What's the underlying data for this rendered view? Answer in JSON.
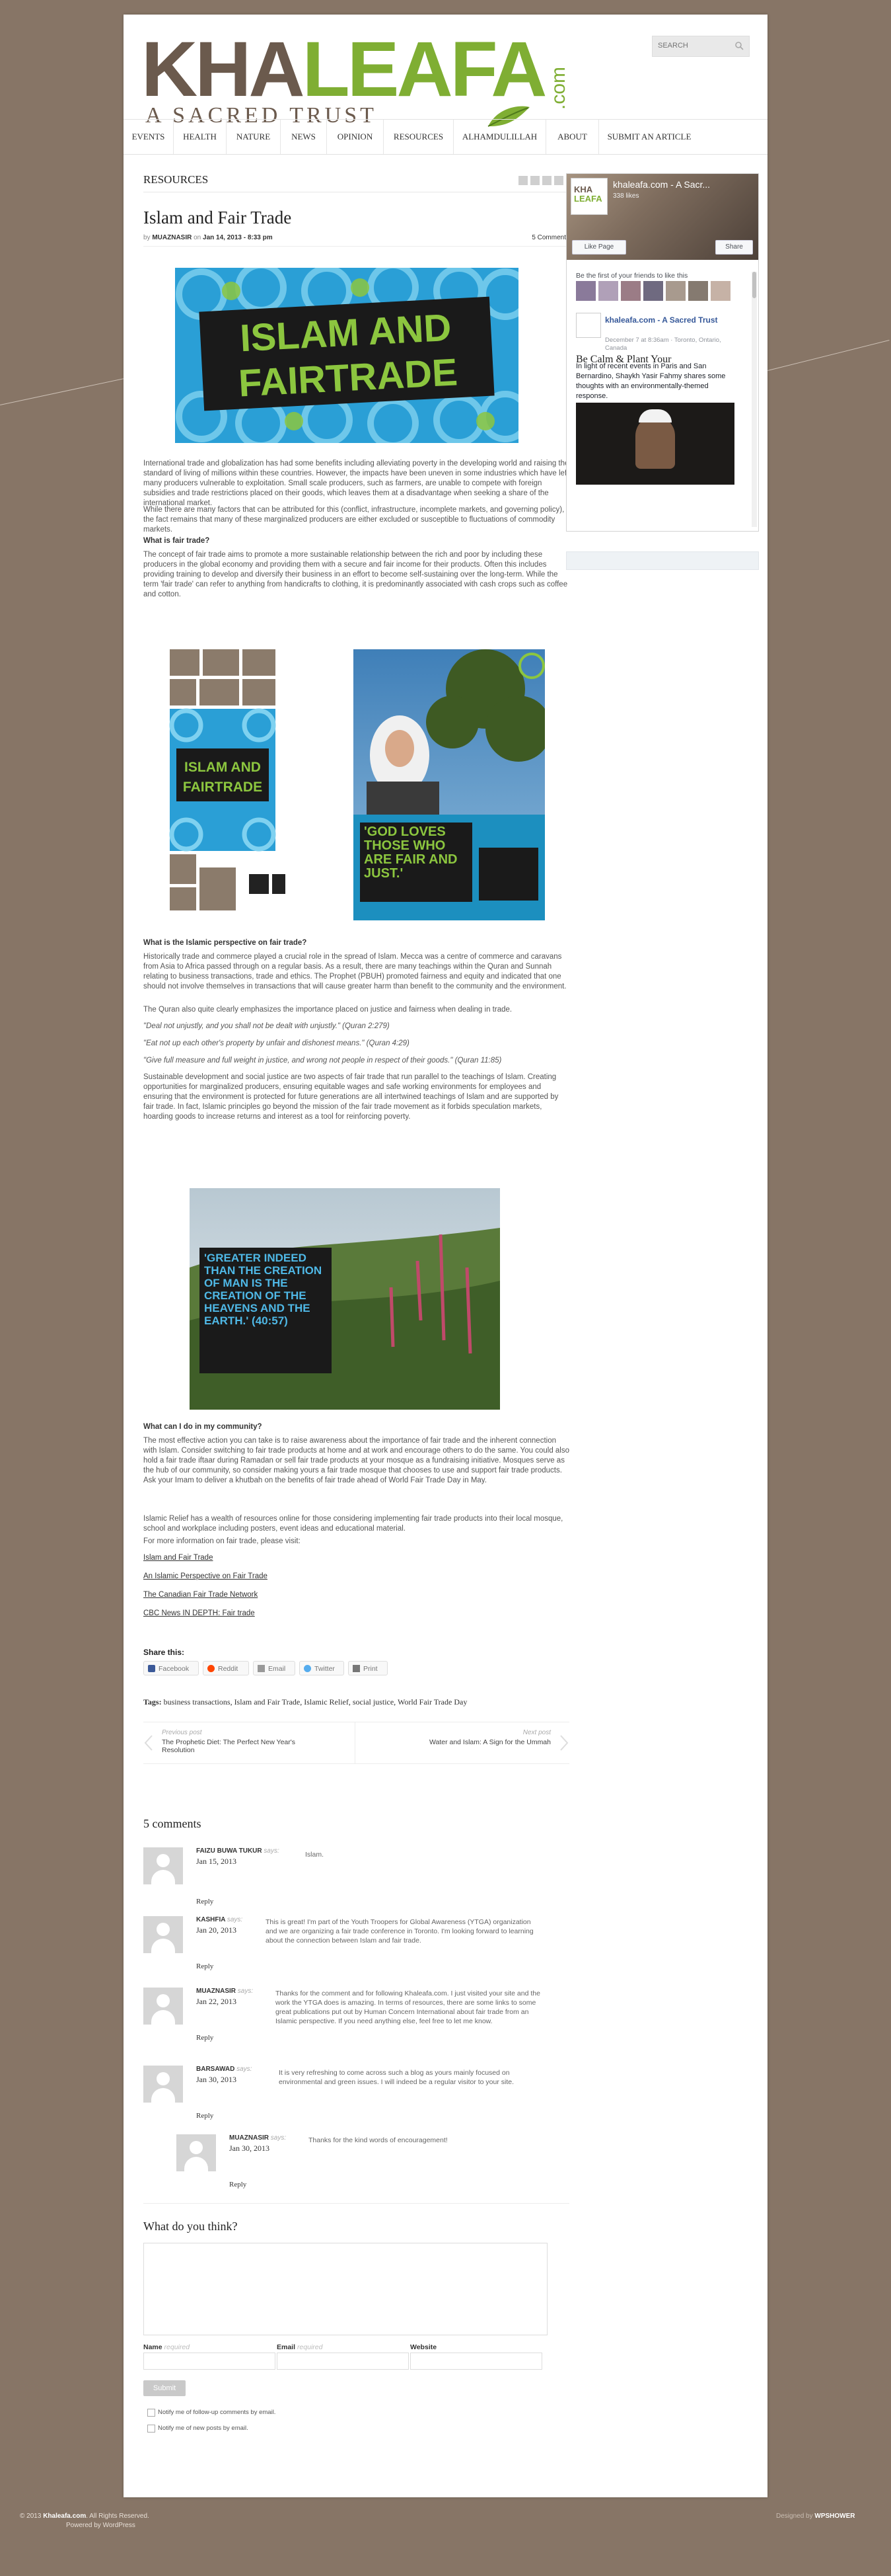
{
  "site": {
    "logo_main": "KHALEAFA",
    "logo_main_dark": "KHA",
    "logo_main_green": "LEAFA",
    "logo_com": ".com",
    "logo_tagline": "A SACRED TRUST",
    "search_placeholder": "SEARCH"
  },
  "nav": [
    "EVENTS",
    "HEALTH",
    "NATURE",
    "NEWS",
    "OPINION",
    "RESOURCES",
    "ALHAMDULILLAH",
    "ABOUT",
    "SUBMIT AN ARTICLE"
  ],
  "section_title": "RESOURCES",
  "post": {
    "title": "Islam and Fair Trade",
    "meta_by": "by",
    "author": "MUAZNASIR",
    "meta_on": "on",
    "date": "Jan 14, 2013 - 8:33 pm",
    "comments_count": "5 Comments",
    "banner_line1": "ISLAM AND",
    "banner_line2": "FAIRTRADE",
    "p1": "International trade and globalization has had some benefits including alleviating poverty in the developing world and raising the standard of living of millions within these countries. However, the impacts have been uneven in some industries which have left many producers vulnerable to exploitation. Small scale producers, such as farmers, are unable to compete with foreign subsidies and trade restrictions placed on their goods, which leaves them at a disadvantage when seeking a share of the international market.",
    "p2": "While there are many factors that can be attributed for this (conflict, infrastructure, incomplete markets, and governing policy), the fact remains that many of these marginalized producers are either excluded or susceptible to fluctuations of commodity markets.",
    "h_what": "What is fair trade?",
    "p3": "The concept of fair trade aims to promote a more sustainable relationship between the rich and poor by including these producers in the global economy and providing them with a secure and fair income for their products. Often this includes providing training to develop and diversify their business in an effort to become self-sustaining over the long-term. While the term 'fair trade' can refer to anything from handicrafts to clothing, it is predominantly associated with cash crops such as coffee and cotton.",
    "poster1_line1": "ISLAM AND",
    "poster1_line2": "FAIRTRADE",
    "poster2_quote": "'GOD LOVES THOSE WHO ARE FAIR AND JUST.'",
    "h_islamic": "What is the Islamic perspective on fair trade?",
    "p4": "Historically trade and commerce played a crucial role in the spread of Islam. Mecca was a centre of commerce and caravans from Asia to Africa passed through on a regular basis. As a result, there are many teachings within the Quran and Sunnah relating to business transactions, trade and ethics. The Prophet (PBUH) promoted fairness and equity and indicated that one should not involve themselves in transactions that will cause greater harm than benefit to the community and the environment.",
    "p5": "The Quran also quite clearly emphasizes the importance placed on justice and fairness when dealing in trade.",
    "q1": "\"Deal not unjustly, and you shall not be dealt with unjustly.\" (Quran 2:279)",
    "q2": "\"Eat not up each other's property by unfair and dishonest means.\" (Quran 4:29)",
    "q3": "\"Give full measure and full weight in justice, and wrong not people in respect of their goods.\" (Quran 11:85)",
    "p6": "Sustainable development and social justice are two aspects of fair trade that run parallel to the teachings of Islam. Creating opportunities for marginalized producers, ensuring equitable wages and safe working environments for employees and ensuring that the environment is protected for future generations are all intertwined teachings of Islam and are supported by fair trade. In fact, Islamic principles go beyond the mission of the fair trade movement as it forbids speculation markets, hoarding goods to increase returns and interest as a tool for reinforcing poverty.",
    "quote_image_text": "'GREATER INDEED THAN THE CREATION OF MAN IS THE CREATION OF THE HEAVENS AND THE EARTH.' (40:57)",
    "h_community": "What can I do in my community?",
    "p7": "The most effective action you can take is to raise awareness about the importance of fair trade and the inherent connection with Islam. Consider switching to fair trade products at home and at work and encourage others to do the same. You could also hold a fair trade iftaar during Ramadan or sell fair trade products at your mosque as a fundraising initiative. Mosques serve as the hub of our community, so consider making yours a fair trade mosque that chooses to use and support fair trade products. Ask your Imam to deliver a khutbah on the benefits of fair trade ahead of World Fair Trade Day in May.",
    "p8": "Islamic Relief has a wealth of resources online for those considering implementing fair trade products into their local mosque, school and workplace including posters, event ideas and educational material.",
    "p9": "For more information on fair trade, please visit:",
    "links": [
      "Islam and Fair Trade",
      "An Islamic Perspective on Fair Trade",
      "The Canadian Fair Trade Network",
      "CBC News IN DEPTH: Fair trade"
    ]
  },
  "share": {
    "title": "Share this:",
    "buttons": [
      "Facebook",
      "Reddit",
      "Email",
      "Twitter",
      "Print"
    ]
  },
  "tags": {
    "label": "Tags:",
    "list": "business transactions, Islam and Fair Trade, Islamic Relief, social justice, World Fair Trade Day"
  },
  "postnav": {
    "prev_label": "Previous post",
    "prev_title": "The Prophetic Diet: The Perfect New Year's Resolution",
    "next_label": "Next post",
    "next_title": "Water and Islam: A Sign for the Ummah"
  },
  "comments": {
    "title": "5 comments",
    "says": "says:",
    "reply": "Reply",
    "items": [
      {
        "author": "FAIZU BUWA TUKUR",
        "date": "Jan 15, 2013",
        "text": "Islam."
      },
      {
        "author": "KASHFIA",
        "date": "Jan 20, 2013",
        "text": "This is great! I'm part of the Youth Troopers for Global Awareness (YTGA) organization and we are organizing a fair trade conference in Toronto. I'm looking forward to learning about the connection between Islam and fair trade."
      },
      {
        "author": "MUAZNASIR",
        "date": "Jan 22, 2013",
        "text": "Thanks for the comment and for following Khaleafa.com. I just visited your site and the work the YTGA does is amazing. In terms of resources, there are some links to some great publications put out by Human Concern International about fair trade from an Islamic perspective. If you need anything else, feel free to let me know."
      },
      {
        "author": "BARSAWAD",
        "date": "Jan 30, 2013",
        "text": "It is very refreshing to come across such a blog as yours mainly focused on environmental and green issues. I will indeed be a regular visitor to your site."
      },
      {
        "author": "MUAZNASIR",
        "date": "Jan 30, 2013",
        "text": "Thanks for the kind words of encouragement!"
      }
    ]
  },
  "form": {
    "title": "What do you think?",
    "name_label": "Name",
    "email_label": "Email",
    "website_label": "Website",
    "required": "required",
    "submit": "Submit",
    "notify_comments": "Notify me of follow-up comments by email.",
    "notify_posts": "Notify me of new posts by email."
  },
  "sidebar": {
    "fb_page_name": "khaleafa.com - A Sacr...",
    "fb_likes": "338 likes",
    "fb_like_btn": "Like Page",
    "fb_share_btn": "Share",
    "fb_friends": "Be the first of your friends to like this",
    "fb_post_name": "khaleafa.com - A Sacred Trust",
    "fb_post_meta": "December 7 at 8:36am · Toronto, Ontario, Canada",
    "fb_post_text": "In light of recent events in Paris and San Bernardino, Shaykh Yasir Fahmy shares some thoughts with an environmentally-themed response.",
    "fb_post_caption": "Be Calm & Plant Your"
  },
  "footer": {
    "copyright": "© 2013",
    "site": "Khaleafa.com",
    "rights": ". All Rights Reserved.",
    "powered": "Powered by WordPress",
    "designed": "Designed by",
    "designer": "WPSHOWER"
  },
  "colors": {
    "page_bg": "#877566",
    "logo_brown": "#6b5a4d",
    "logo_green": "#7fae33",
    "banner_blue": "#2a9fd6"
  }
}
